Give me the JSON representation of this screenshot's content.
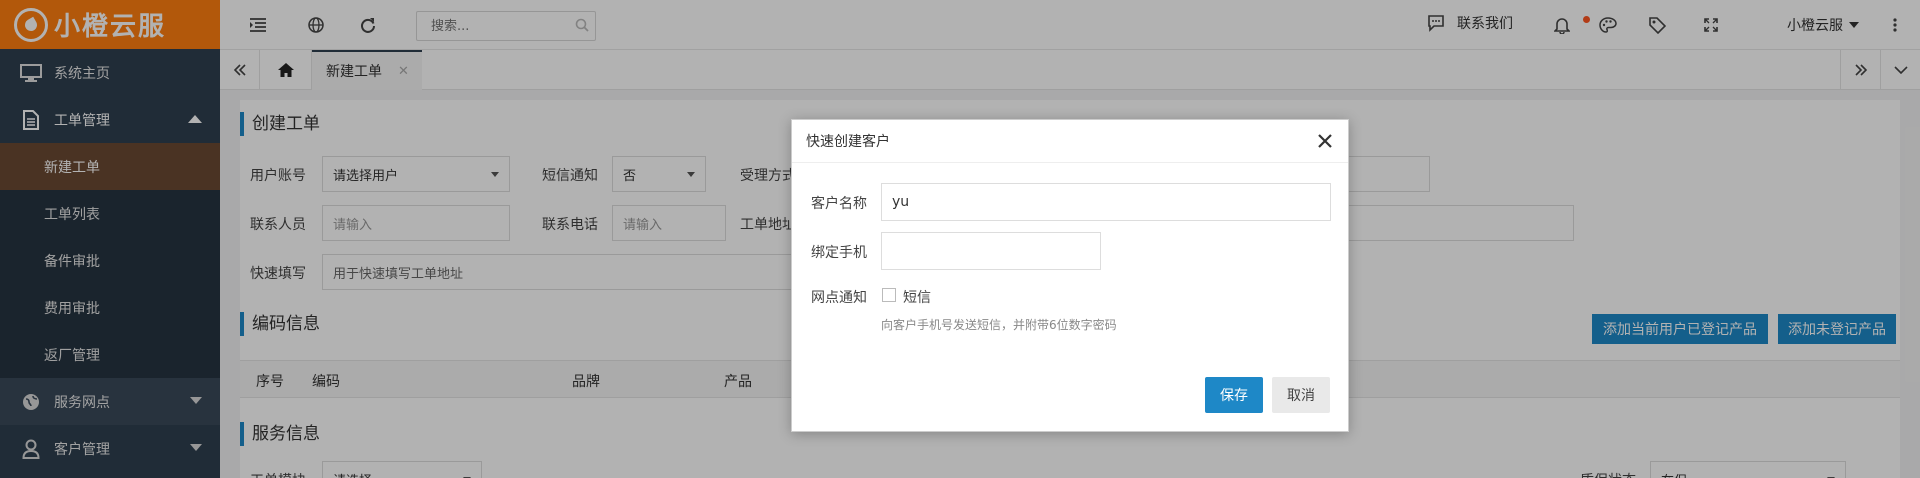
{
  "brand": {
    "name": "小橙云服",
    "color": "#ff7f11"
  },
  "sidebar": {
    "items": [
      {
        "label": "系统主页",
        "icon": "monitor-icon"
      },
      {
        "label": "工单管理",
        "icon": "document-icon",
        "expanded": true
      },
      {
        "label": "服务网点",
        "icon": "globe-icon"
      },
      {
        "label": "客户管理",
        "icon": "user-icon"
      }
    ],
    "submenu": [
      {
        "label": "新建工单",
        "active": true
      },
      {
        "label": "工单列表"
      },
      {
        "label": "备件审批"
      },
      {
        "label": "费用审批"
      },
      {
        "label": "返厂管理"
      }
    ]
  },
  "header": {
    "search_placeholder": "搜索...",
    "contact_label": "联系我们",
    "user_name": "小橙云服"
  },
  "tabs": {
    "active_label": "新建工单"
  },
  "page": {
    "section1_title": "创建工单",
    "user_account_label": "用户账号",
    "user_account_value": "请选择用户",
    "sms_label": "短信通知",
    "sms_value": "否",
    "accept_label": "受理方式",
    "contact_person_label": "联系人员",
    "contact_person_placeholder": "请输入",
    "phone_label": "联系电话",
    "phone_placeholder": "请输入",
    "address_label": "工单地址",
    "quick_fill_label": "快速填写",
    "quick_fill_placeholder": "用于快速填写工单地址",
    "section2_title": "编码信息",
    "add_registered_btn": "添加当前用户已登记产品",
    "add_unregistered_btn": "添加未登记产品",
    "table_headers": [
      "序号",
      "编码",
      "品牌",
      "产品"
    ],
    "section3_title": "服务信息",
    "ticket_type_label": "工单模块",
    "ticket_type_value": "请选择",
    "warranty_label": "质保状态",
    "warranty_value": "在保"
  },
  "modal": {
    "title": "快速创建客户",
    "name_label": "客户名称",
    "name_value": "yu",
    "phone_label": "绑定手机",
    "phone_value": "",
    "notify_label": "网点通知",
    "sms_checkbox_label": "短信",
    "hint": "向客户手机号发送短信，并附带6位数字密码",
    "save_label": "保存",
    "cancel_label": "取消"
  }
}
